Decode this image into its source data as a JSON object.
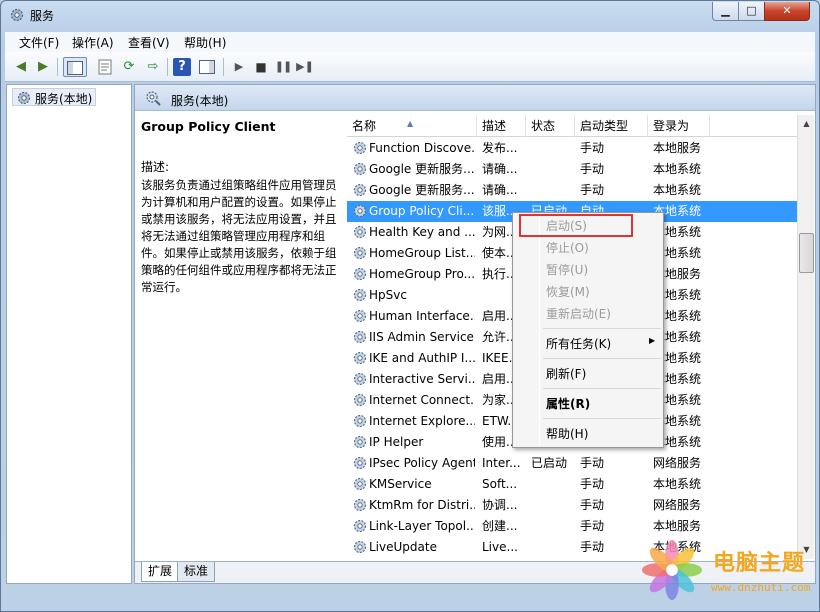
{
  "window": {
    "title": "服务",
    "min_glyph": "▁",
    "max_glyph": "□",
    "close_glyph": "✕"
  },
  "menu": [
    "文件(F)",
    "操作(A)",
    "查看(V)",
    "帮助(H)"
  ],
  "tree": {
    "item": "服务(本地)"
  },
  "content": {
    "header": "服务(本地)",
    "desc_name": "Group Policy Client",
    "desc_label": "描述:",
    "desc_text": "该服务负责通过组策略组件应用管理员为计算机和用户配置的设置。如果停止或禁用该服务，将无法应用设置，并且将无法通过组策略管理应用程序和组件。如果停止或禁用该服务，依赖于组策略的任何组件或应用程序都将无法正常运行。"
  },
  "columns": [
    "名称",
    "描述",
    "状态",
    "启动类型",
    "登录为"
  ],
  "services": [
    {
      "name": "Function Discove...",
      "desc": "发布...",
      "status": "",
      "startup": "手动",
      "logon": "本地服务"
    },
    {
      "name": "Google 更新服务...",
      "desc": "请确...",
      "status": "",
      "startup": "手动",
      "logon": "本地系统"
    },
    {
      "name": "Google 更新服务...",
      "desc": "请确...",
      "status": "",
      "startup": "手动",
      "logon": "本地系统"
    },
    {
      "name": "Group Policy Cli...",
      "desc": "该服...",
      "status": "已启动",
      "startup": "自动",
      "logon": "本地系统"
    },
    {
      "name": "Health Key and ...",
      "desc": "为网...",
      "status": "",
      "startup": "",
      "logon": "本地系统"
    },
    {
      "name": "HomeGroup List...",
      "desc": "使本...",
      "status": "",
      "startup": "",
      "logon": "本地系统"
    },
    {
      "name": "HomeGroup Pro...",
      "desc": "执行...",
      "status": "",
      "startup": "",
      "logon": "本地服务"
    },
    {
      "name": "HpSvc",
      "desc": "",
      "status": "",
      "startup": "",
      "logon": "本地系统"
    },
    {
      "name": "Human Interface...",
      "desc": "启用...",
      "status": "",
      "startup": "",
      "logon": "本地系统"
    },
    {
      "name": "IIS Admin Service",
      "desc": "允许...",
      "status": "",
      "startup": "",
      "logon": "本地系统"
    },
    {
      "name": "IKE and AuthIP I...",
      "desc": "IKEE...",
      "status": "",
      "startup": "",
      "logon": "本地系统"
    },
    {
      "name": "Interactive Servi...",
      "desc": "启用...",
      "status": "",
      "startup": "",
      "logon": "本地系统"
    },
    {
      "name": "Internet Connect...",
      "desc": "为家...",
      "status": "",
      "startup": "",
      "logon": "本地系统"
    },
    {
      "name": "Internet Explore...",
      "desc": "ETW...",
      "status": "",
      "startup": "",
      "logon": "本地系统"
    },
    {
      "name": "IP Helper",
      "desc": "使用...",
      "status": "",
      "startup": "",
      "logon": "本地系统"
    },
    {
      "name": "IPsec Policy Agent",
      "desc": "Inter...",
      "status": "已启动",
      "startup": "手动",
      "logon": "网络服务"
    },
    {
      "name": "KMService",
      "desc": "Soft...",
      "status": "",
      "startup": "手动",
      "logon": "本地系统"
    },
    {
      "name": "KtmRm for Distri...",
      "desc": "协调...",
      "status": "",
      "startup": "手动",
      "logon": "网络服务"
    },
    {
      "name": "Link-Layer Topol...",
      "desc": "创建...",
      "status": "",
      "startup": "手动",
      "logon": "本地服务"
    },
    {
      "name": "LiveUpdate",
      "desc": "Live...",
      "status": "",
      "startup": "手动",
      "logon": "本地系统"
    }
  ],
  "selected_index": 3,
  "context_menu": {
    "start": "启动(S)",
    "stop": "停止(O)",
    "pause": "暂停(U)",
    "resume": "恢复(M)",
    "restart": "重新启动(E)",
    "all_tasks": "所有任务(K)",
    "refresh": "刷新(F)",
    "properties": "属性(R)",
    "help": "帮助(H)"
  },
  "tabs": [
    "扩展",
    "标准"
  ],
  "watermark": {
    "title": "电脑主题",
    "url": "www.dnzhuti.com"
  },
  "colors": {
    "selection": "#3399ff",
    "highlight_box": "#e03434",
    "watermark": "#f3a71e"
  }
}
